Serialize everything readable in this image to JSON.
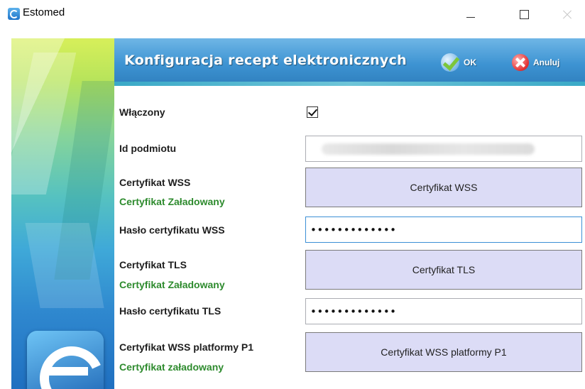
{
  "window": {
    "title": "Estomed"
  },
  "header": {
    "title": "Konfiguracja recept elektronicznych",
    "ok_label": "OK",
    "cancel_label": "Anuluj"
  },
  "form": {
    "enabled": {
      "label": "Włączony",
      "checked": true
    },
    "entity_id": {
      "label": "Id podmiotu",
      "value": ""
    },
    "wss_cert": {
      "label": "Certyfikat WSS",
      "status": "Certyfikat Załadowany",
      "button": "Certyfikat WSS"
    },
    "wss_password": {
      "label": "Hasło certyfikatu WSS",
      "value": "•••••••••••••"
    },
    "tls_cert": {
      "label": "Certyfikat TLS",
      "status": "Certyfikat Załadowany",
      "button": "Certyfikat TLS"
    },
    "tls_password": {
      "label": "Hasło certyfikatu TLS",
      "value": "•••••••••••••"
    },
    "p1_cert": {
      "label": "Certyfikat WSS platformy P1",
      "status": "Certyfikat załadowany",
      "button": "Certyfikat WSS platformy P1"
    }
  },
  "colors": {
    "header": "#3d93d2",
    "status_ok": "#2e8b2e",
    "cert_button": "#dcdcf6",
    "focus_border": "#3c8fd6"
  }
}
